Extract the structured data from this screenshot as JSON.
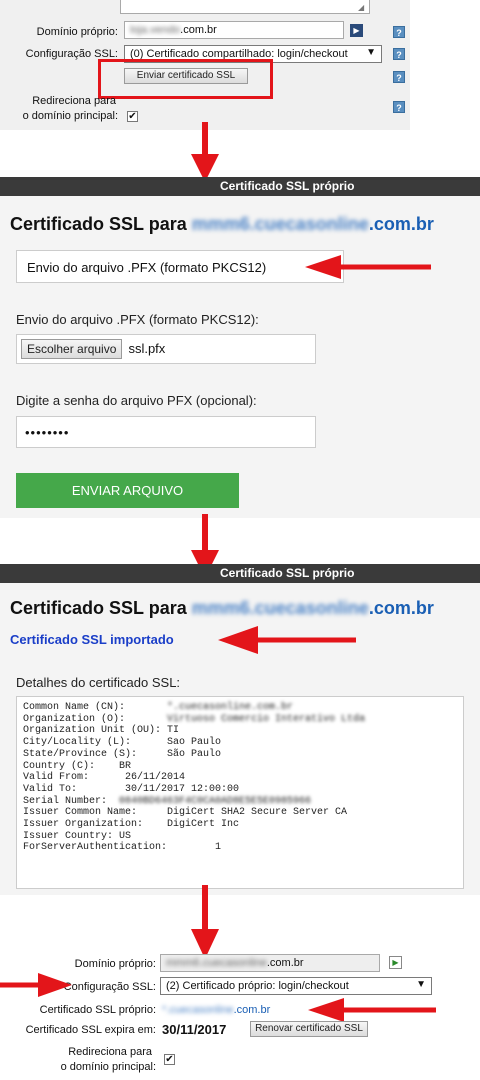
{
  "section1": {
    "dominio_label": "Domínio próprio:",
    "dominio_value_blur": "loja.vendo",
    "dominio_value_suffix": ".com.br",
    "config_label": "Configuração SSL:",
    "config_value": "(0) Certificado compartilhado: login/checkout",
    "send_cert_button": "Enviar certificado SSL",
    "redirect_label_1": "Redireciona para",
    "redirect_label_2": "o domínio principal:",
    "help": "?"
  },
  "panel2": {
    "bar_title": "Certificado SSL próprio",
    "heading_prefix": "Certificado SSL para ",
    "heading_domain_blur": "mmm6.cuecasonline",
    "heading_domain_suffix": ".com.br",
    "format_select": "Envio do arquivo .PFX (formato PKCS12)",
    "upload_label": "Envio do arquivo .PFX (formato PKCS12):",
    "choose_file_button": "Escolher arquivo",
    "file_name": "ssl.pfx",
    "password_label": "Digite a senha do arquivo PFX (opcional):",
    "password_value": "••••••••",
    "submit_button": "ENVIAR ARQUIVO"
  },
  "panel3": {
    "bar_title": "Certificado SSL próprio",
    "heading_prefix": "Certificado SSL para ",
    "heading_domain_blur": "mmm6.cuecasonline",
    "heading_domain_suffix": ".com.br",
    "imported_text": "Certificado SSL importado",
    "details_label": "Detalhes do certificado SSL:",
    "details": [
      {
        "key": "Common Name (CN):       ",
        "value": "*.cuecasonline.com.br"
      },
      {
        "key": "Organization (O):       ",
        "value": "Virtuoso Comercio Interativo Ltda"
      },
      {
        "key": "Organization Unit (OU): ",
        "value": "TI"
      },
      {
        "key": "City/Locality (L):      ",
        "value": "Sao Paulo"
      },
      {
        "key": "State/Province (S):     ",
        "value": "São Paulo"
      },
      {
        "key": "Country (C):    ",
        "value": "BR"
      },
      {
        "key": "Valid From:      ",
        "value": "26/11/2014"
      },
      {
        "key": "Valid To:        ",
        "value": "30/11/2017 12:00:00"
      },
      {
        "key": "Serial Number:  ",
        "value": "0840BD6463F4C0CA0AD8E5E5E0985966"
      },
      {
        "key": "Issuer Common Name:     ",
        "value": "DigiCert SHA2 Secure Server CA"
      },
      {
        "key": "Issuer Organization:    ",
        "value": "DigiCert Inc"
      },
      {
        "key": "Issuer Country: ",
        "value": "US"
      },
      {
        "key": "ForServerAuthentication:        ",
        "value": "1"
      }
    ]
  },
  "section4": {
    "dominio_label": "Domínio próprio:",
    "dominio_value_blur": "mmm6.cuecasonline",
    "dominio_value_suffix": ".com.br",
    "config_label": "Configuração SSL:",
    "config_value": "(2) Certificado próprio: login/checkout",
    "cert_label": "Certificado SSL próprio:",
    "cert_value_blur": "*.cuecasonline",
    "cert_value_suffix": ".com.br",
    "expira_label": "Certificado SSL expira em:",
    "expira_value": "30/11/2017",
    "renew_button": "Renovar certificado SSL",
    "redirect_label_1": "Redireciona para",
    "redirect_label_2": "o domínio principal:"
  },
  "colors": {
    "red_arrow": "#e3151a",
    "bar_bg": "#3a3a3a",
    "green_button": "#45a84a",
    "link_blue": "#1a5fb4",
    "imported_blue": "#1a3ec8"
  }
}
